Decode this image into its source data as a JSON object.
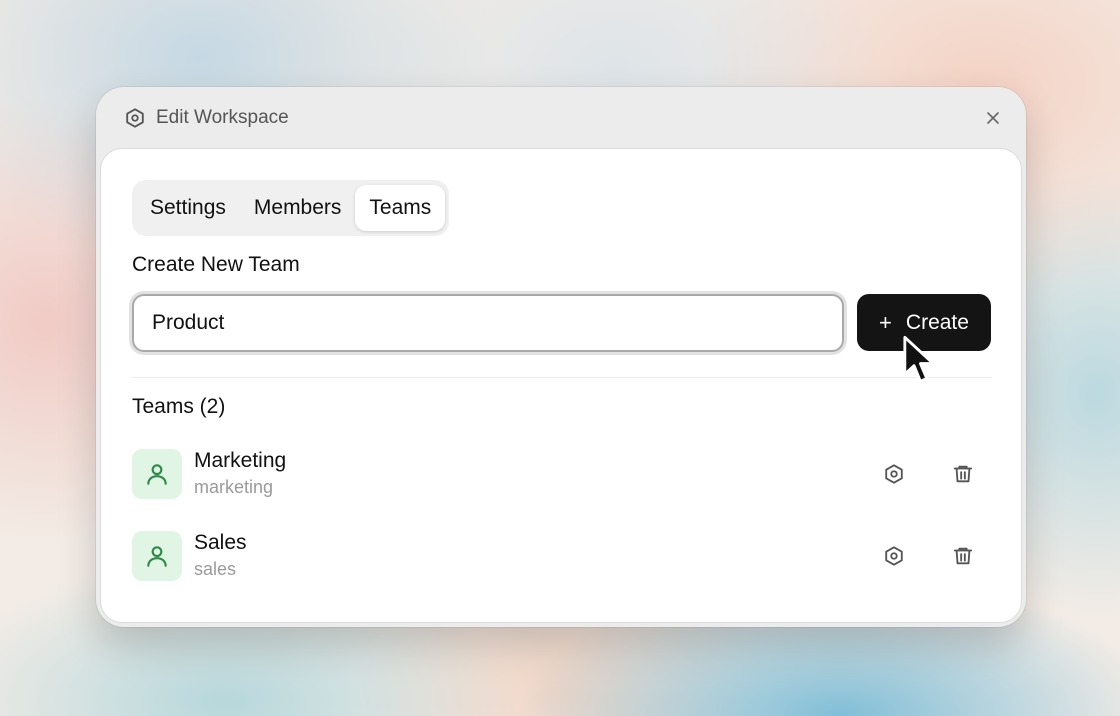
{
  "window": {
    "title": "Edit Workspace",
    "title_icon": "hexagon-settings-icon",
    "close_icon": "close-icon"
  },
  "tabs": [
    {
      "label": "Settings",
      "active": false
    },
    {
      "label": "Members",
      "active": false
    },
    {
      "label": "Teams",
      "active": true
    }
  ],
  "create_section": {
    "label": "Create New Team",
    "input_value": "Product",
    "button_label": "Create",
    "button_icon": "plus-icon"
  },
  "teams_list": {
    "label": "Teams (2)",
    "items": [
      {
        "name": "Marketing",
        "slug": "marketing",
        "avatar_icon": "user-icon"
      },
      {
        "name": "Sales",
        "slug": "sales",
        "avatar_icon": "user-icon"
      }
    ]
  },
  "colors": {
    "primary_button": "#141414",
    "avatar_bg": "#e1f5e4",
    "avatar_icon": "#2f8a4a",
    "muted_text": "#9a9a9a"
  }
}
